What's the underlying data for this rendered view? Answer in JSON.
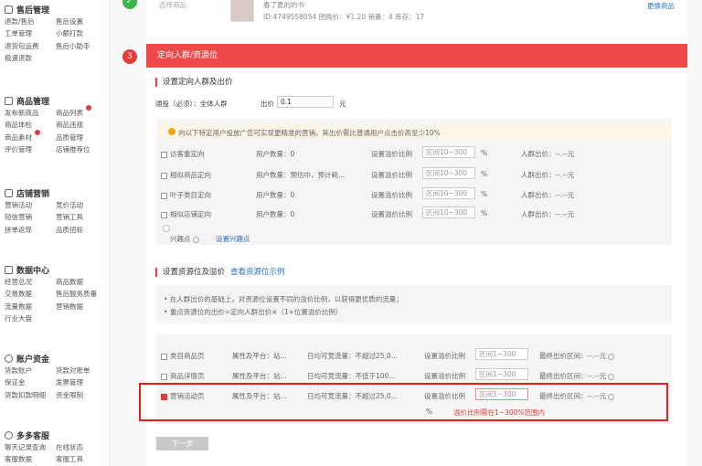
{
  "sidebar": {
    "after_sale": {
      "title": "售后管理",
      "rows": [
        [
          "退款/售后",
          "售后设置"
        ],
        [
          "工单管理",
          "小额打款"
        ],
        [
          "退货包运费",
          "售后小助手"
        ],
        [
          "极速退款",
          ""
        ]
      ]
    },
    "goods": {
      "title": "商品管理",
      "rows": [
        [
          "发布新商品",
          "商品列表"
        ],
        [
          "商品体检",
          "商品违规"
        ],
        [
          "商品素材",
          "品质管理"
        ],
        [
          "评价管理",
          "店铺推荐位"
        ]
      ]
    },
    "shop": {
      "title": "店铺营销",
      "rows": [
        [
          "营销活动",
          "竞价活动"
        ],
        [
          "短信营销",
          "营销工具"
        ],
        [
          "拼单返现",
          "品质招标"
        ]
      ]
    },
    "data": {
      "title": "数据中心",
      "rows": [
        [
          "经营总况",
          "商品数据"
        ],
        [
          "交易数据",
          "售后服务质量"
        ],
        [
          "流量数据",
          "营销数据"
        ],
        [
          "行业大盘",
          ""
        ]
      ]
    },
    "funds": {
      "title": "账户资金",
      "rows": [
        [
          "货款账户",
          "货款对账单"
        ],
        [
          "保证金",
          "发票管理"
        ],
        [
          "货款扣款明细",
          "资金限制"
        ]
      ]
    },
    "service": {
      "title": "多多客服",
      "rows": [
        [
          "聊天记录查询",
          "在线状态"
        ],
        [
          "客服数据",
          "客服工具"
        ]
      ]
    }
  },
  "top": {
    "check": "✓",
    "product_label": "选择商品",
    "product_title": "春了夏的的书",
    "product_meta": "ID:4749558054   团购价：¥1.20   销量：4   库存：17",
    "change_link": "更换商品"
  },
  "step": {
    "num": "3",
    "title": "定向人群/资源位"
  },
  "crowd": {
    "title": "设置定向人群及出价",
    "base_label": "通投（必须）：全体人群",
    "bid_label": "出价",
    "bid_value": "0.1",
    "unit": "元",
    "tip": "向以下特定用户投放广告可实现更精准的营销，其出价需比普通用户点击价高至少10%",
    "rows": [
      {
        "name": "访客重定向",
        "count": "用户数量：0",
        "premium_label": "设置溢价比例",
        "placeholder": "区间10~300",
        "pct": "%",
        "bid": "人群出价：--.--元"
      },
      {
        "name": "相似商品定向",
        "count": "用户数量：预估中，预计耗...",
        "premium_label": "设置溢价比例",
        "placeholder": "区间10~300",
        "pct": "%",
        "bid": "人群出价：--.--元"
      },
      {
        "name": "叶子类目定向",
        "count": "用户数量：0",
        "premium_label": "设置溢价比例",
        "placeholder": "区间10~300",
        "pct": "%",
        "bid": "人群出价：--.--元"
      },
      {
        "name": "相似店铺定向",
        "count": "用户数量：0",
        "premium_label": "设置溢价比例",
        "placeholder": "区间10~300",
        "pct": "%",
        "bid": "人群出价：--.--元"
      }
    ],
    "interest_label": "兴趣点",
    "interest_link": "设置兴趣点"
  },
  "resource": {
    "title": "设置资源位及溢价",
    "example_link": "查看资源位示例",
    "notes": [
      "在人群出价的基础上，对资源位设置不同的溢价比例，以获得更优质的流量；",
      "重点资源位的出价=定向人群出价×（1+位置溢价比例）"
    ],
    "rows": [
      {
        "name": "类目商品页",
        "attr": "属性及平台：站...",
        "traffic": "日均可竞流量：不超过25,0...",
        "premium_label": "设置溢价比例",
        "placeholder": "区间1~300",
        "range": "最终出价区间：--.--元",
        "checked": false
      },
      {
        "name": "商品详情页",
        "attr": "属性及平台：站...",
        "traffic": "日均可竞流量：不低于100...",
        "premium_label": "设置溢价比例",
        "placeholder": "区间1~300",
        "range": "最终出价区间：--.--元",
        "checked": false
      },
      {
        "name": "营销活动页",
        "attr": "属性及平台：站...",
        "traffic": "日均可竞流量：不超过25,0...",
        "premium_label": "设置溢价比例",
        "placeholder": "区间1~300",
        "range": "最终出价区间：--.--元",
        "checked": true
      }
    ],
    "pct": "%",
    "error": "溢价比例需在1~300%范围内"
  },
  "next_button": "下一步",
  "colors": {
    "accent": "#ee4a4a",
    "link": "#2a70c9",
    "success": "#3bb54a"
  }
}
